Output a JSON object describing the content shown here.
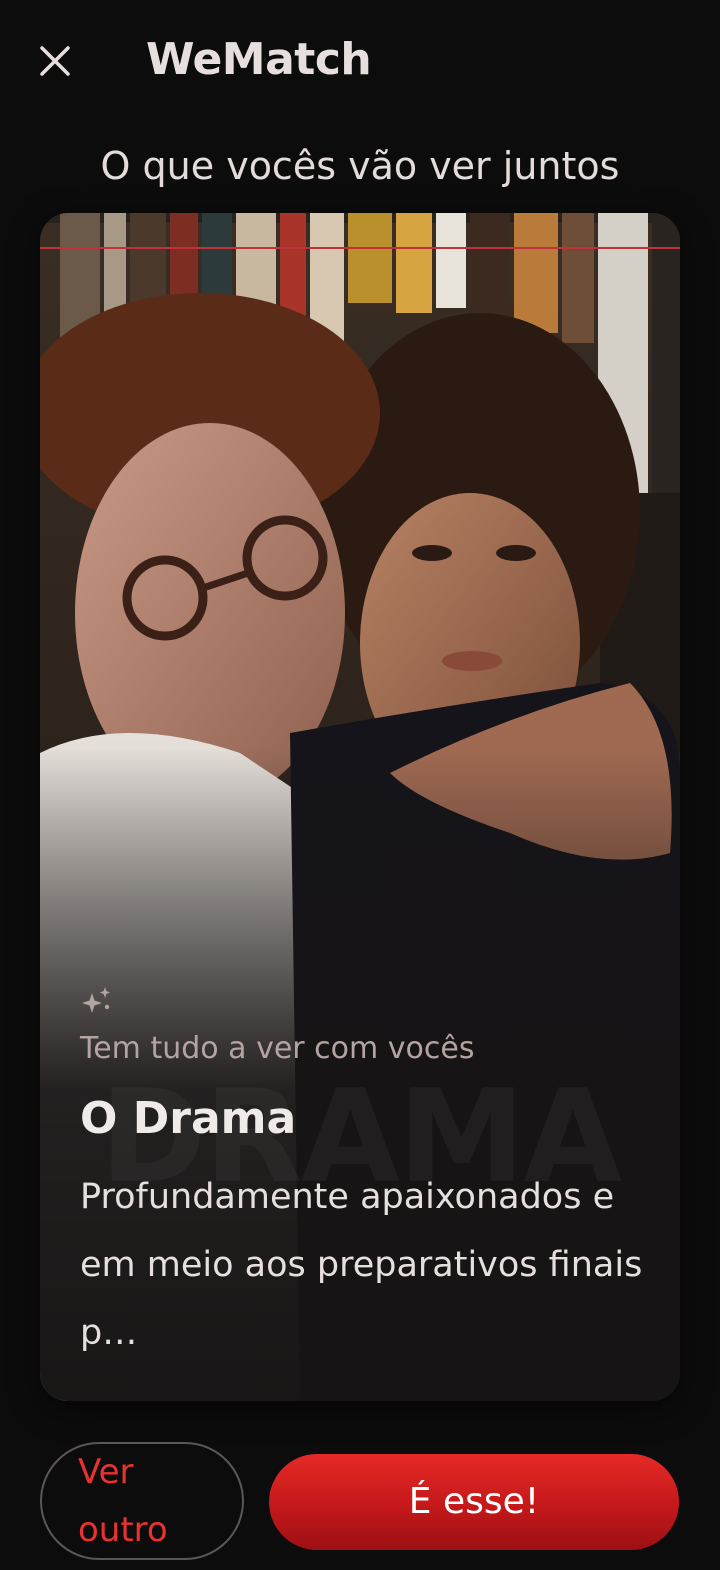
{
  "header": {
    "close_icon": "close-icon",
    "app_title": "WeMatch"
  },
  "subtitle": "O que vocês vão ver juntos",
  "card": {
    "sparkle_icon": "sparkle-icon",
    "tagline": "Tem tudo a ver com vocês",
    "movie_title": "O Drama",
    "watermark": "DRAMA",
    "description": "Profundamente apaixonados e em meio aos preparativos finais p…"
  },
  "actions": {
    "secondary_label": "Ver outro",
    "primary_label": "É esse!"
  },
  "colors": {
    "background": "#0d0c0d",
    "accent_red": "#e52a26",
    "secondary_text": "#e8322f"
  }
}
